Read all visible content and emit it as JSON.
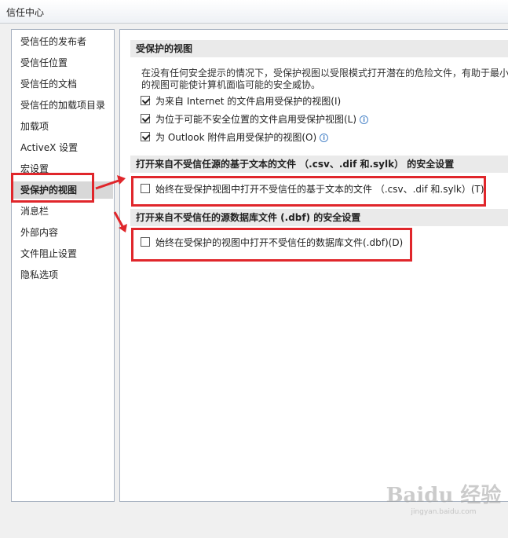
{
  "window": {
    "title": "信任中心"
  },
  "sidebar": {
    "items": [
      {
        "label": "受信任的发布者"
      },
      {
        "label": "受信任位置"
      },
      {
        "label": "受信任的文档"
      },
      {
        "label": "受信任的加载项目录"
      },
      {
        "label": "加载项"
      },
      {
        "label": "ActiveX 设置"
      },
      {
        "label": "宏设置"
      },
      {
        "label": "受保护的视图",
        "selected": true
      },
      {
        "label": "消息栏"
      },
      {
        "label": "外部内容"
      },
      {
        "label": "文件阻止设置"
      },
      {
        "label": "隐私选项"
      }
    ]
  },
  "main": {
    "protected_view": {
      "header": "受保护的视图",
      "desc_line1": "在没有任何安全提示的情况下，受保护视图以受限模式打开潜在的危险文件，有助于最小",
      "desc_line2": "的视图可能使计算机面临可能的安全威协。",
      "options": [
        {
          "label": "为来自 Internet 的文件启用受保护的视图(I)",
          "checked": true
        },
        {
          "label": "为位于可能不安全位置的文件启用受保护视图(L)",
          "checked": true
        },
        {
          "label": "为 Outlook 附件启用受保护的视图(O)",
          "checked": true
        }
      ]
    },
    "text_files": {
      "header": "打开来自不受信任源的基于文本的文件 （.csv、.dif 和.sylk） 的安全设置",
      "option": {
        "label": "始终在受保护视图中打开不受信任的基于文本的文件 （.csv、.dif 和.sylk）(T)",
        "checked": false
      }
    },
    "database_files": {
      "header": "打开来自不受信任的源数据库文件 (.dbf) 的安全设置",
      "option": {
        "label": "始终在受保护的视图中打开不受信任的数据库文件(.dbf)(D)",
        "checked": false
      }
    }
  },
  "watermark": {
    "logo": "Baidu 经验",
    "url": "jingyan.baidu.com"
  },
  "colors": {
    "highlight": "#e0262b",
    "selected_bg": "#d8d8d8",
    "section_bg": "#eaeaea",
    "info": "#4d86c9"
  }
}
